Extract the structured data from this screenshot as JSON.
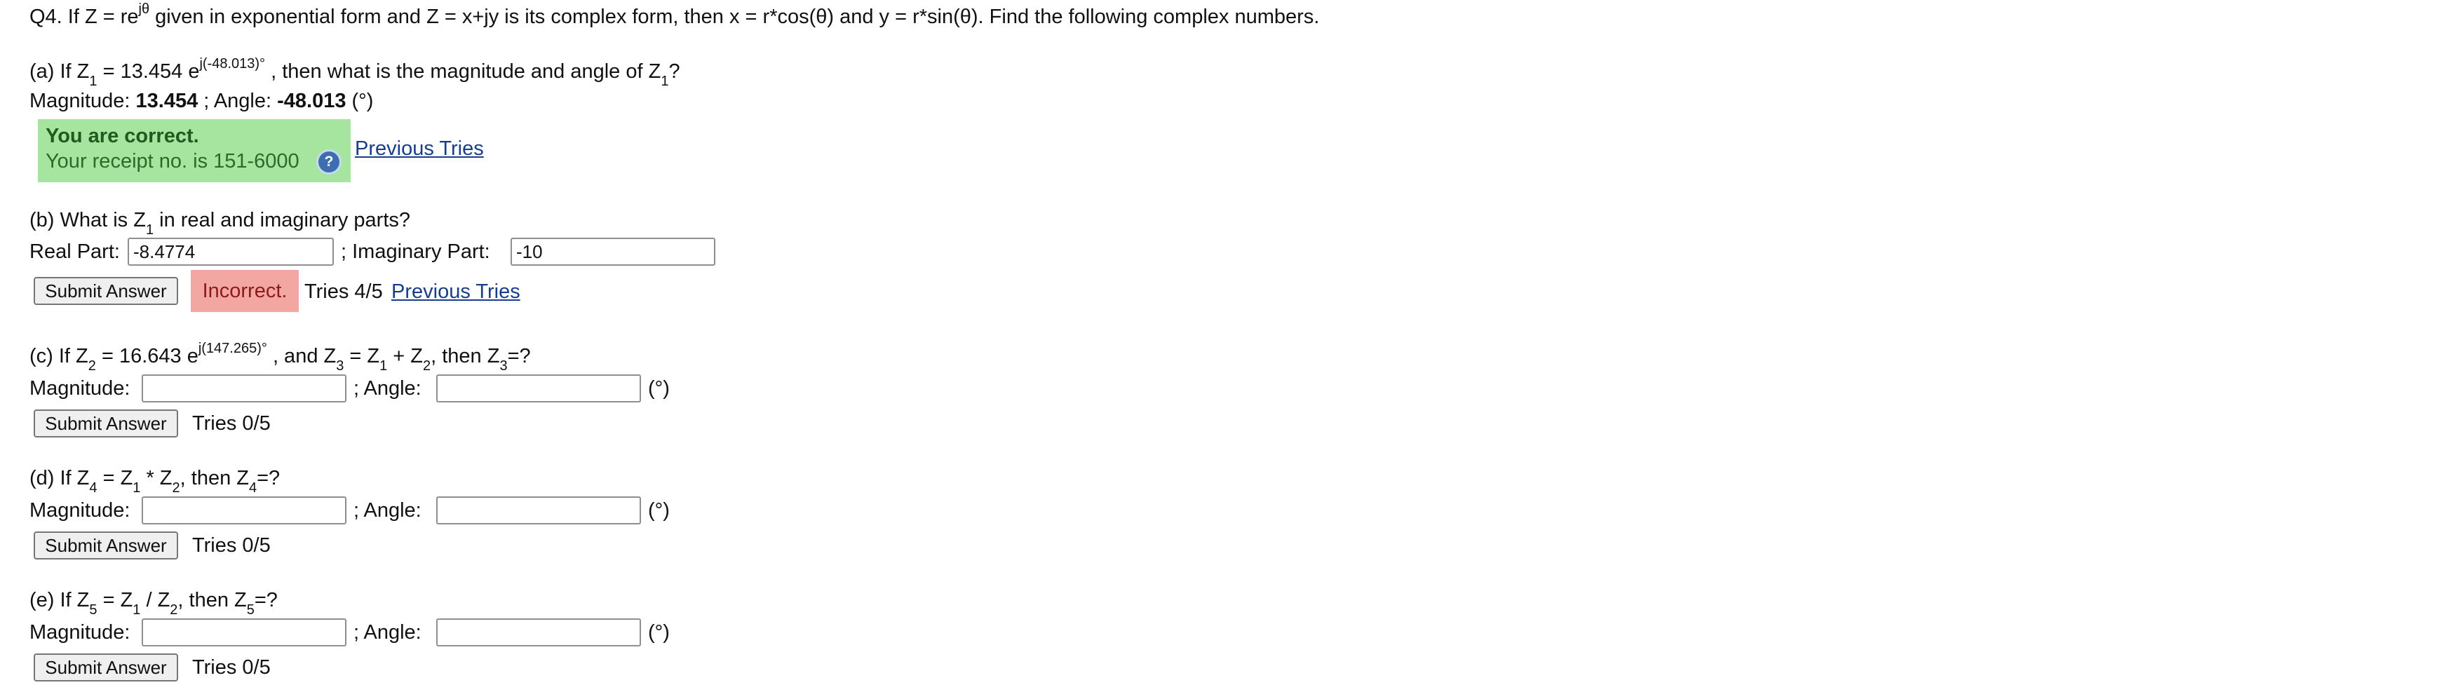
{
  "intro": {
    "prefix": "Q4. If Z = re",
    "sup": "jθ",
    "rest": " given in exponential form and Z = x+jy is its complex form, then x = r*cos(θ) and y = r*sin(θ). Find the following complex numbers."
  },
  "part_a": {
    "q_prefix": "(a) If Z",
    "sub1": "1",
    "q_mid": " = 13.454 e",
    "q_sup": "j(-48.013)°",
    "q_mid2": " , then what is the magnitude and angle of Z",
    "sub2": "1",
    "q_end": "?",
    "mag_label": "Magnitude: ",
    "mag_value": "13.454",
    "sep": " ; Angle: ",
    "angle_value": "-48.013",
    "unit": " (°)",
    "correct_title": "You are correct.",
    "receipt": "Your receipt no. is 151-6000",
    "help_icon": "?",
    "prev_tries": "Previous Tries"
  },
  "part_b": {
    "q_prefix": "(b) What is Z",
    "sub1": "1",
    "q_end": " in real and imaginary parts?",
    "real_label": "Real Part:",
    "real_value": "-8.4774",
    "imag_label": "; Imaginary Part:",
    "imag_value": "-10",
    "submit": "Submit Answer",
    "status": "Incorrect.",
    "tries": "Tries 4/5",
    "prev_tries": "Previous Tries"
  },
  "part_c": {
    "q_prefix": "(c) If Z",
    "sub1": "2",
    "q_mid": " = 16.643 e",
    "q_sup": "j(147.265)°",
    "q_mid2": " , and Z",
    "sub2": "3",
    "q_mid3": " = Z",
    "sub3": "1",
    "q_mid4": " + Z",
    "sub4": "2",
    "q_mid5": ", then Z",
    "sub5": "3",
    "q_end": "=?",
    "mag_label": "Magnitude:",
    "angle_label": "; Angle:",
    "unit": "(°)",
    "submit": "Submit Answer",
    "tries": "Tries 0/5"
  },
  "part_d": {
    "q_prefix": "(d) If Z",
    "sub1": "4",
    "q_mid": " = Z",
    "sub2": "1",
    "q_mid2": " * Z",
    "sub3": "2",
    "q_mid3": ", then Z",
    "sub4": "4",
    "q_end": "=?",
    "mag_label": "Magnitude:",
    "angle_label": "; Angle:",
    "unit": "(°)",
    "submit": "Submit Answer",
    "tries": "Tries 0/5"
  },
  "part_e": {
    "q_prefix": "(e) If Z",
    "sub1": "5",
    "q_mid": " = Z",
    "sub2": "1",
    "q_mid2": " / Z",
    "sub3": "2",
    "q_mid3": ", then Z",
    "sub4": "5",
    "q_end": "=?",
    "mag_label": "Magnitude:",
    "angle_label": "; Angle:",
    "unit": "(°)",
    "submit": "Submit Answer",
    "tries": "Tries 0/5"
  },
  "colors": {
    "correct_bg": "#a5e5a0",
    "incorrect_bg": "#f3a7a2",
    "link": "#1a3d8a"
  }
}
